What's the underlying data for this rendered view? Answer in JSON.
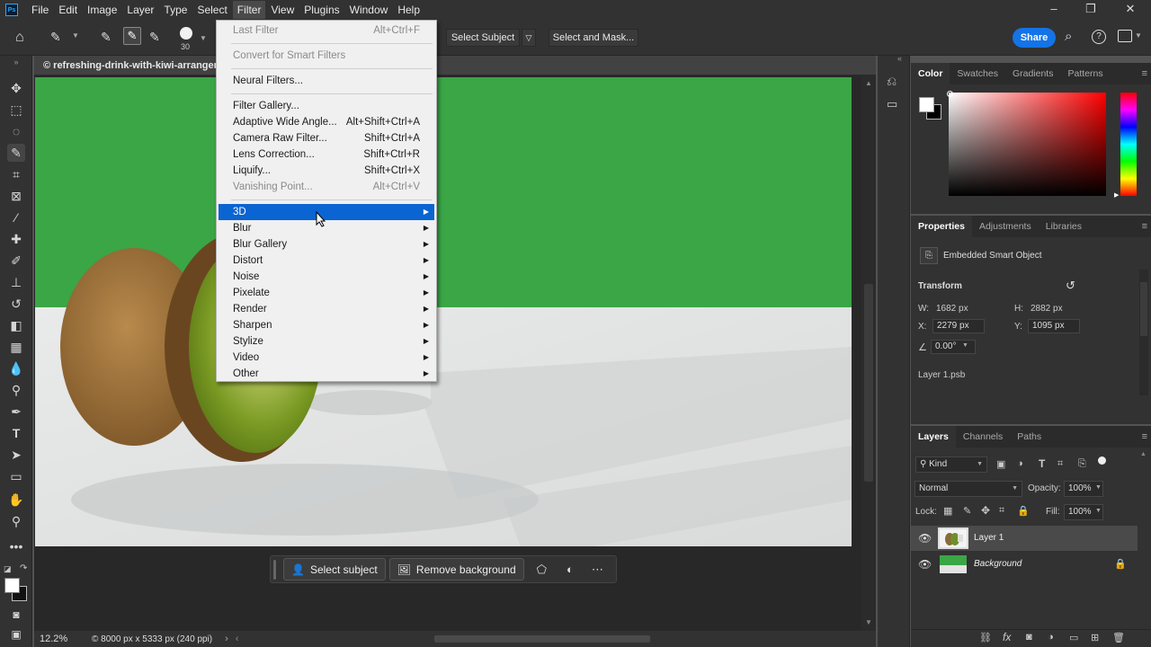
{
  "menubar": {
    "logo": "Ps",
    "items": [
      "File",
      "Edit",
      "Image",
      "Layer",
      "Type",
      "Select",
      "Filter",
      "View",
      "Plugins",
      "Window",
      "Help"
    ],
    "active": "Filter"
  },
  "options": {
    "brush_size": "30",
    "select_subject": "Select Subject",
    "select_and_mask": "Select and Mask...",
    "share": "Share"
  },
  "document": {
    "tab_title": "© refreshing-drink-with-kiwi-arrangem",
    "zoom": "12.2%",
    "doc_info": "© 8000 px x 5333 px (240 ppi)"
  },
  "filter_menu": {
    "items": [
      {
        "label": "Last Filter",
        "shortcut": "Alt+Ctrl+F",
        "disabled": true
      },
      {
        "label": "Convert for Smart Filters",
        "shortcut": "",
        "disabled": true
      },
      {
        "label": "Neural Filters...",
        "shortcut": ""
      },
      {
        "label": "Filter Gallery...",
        "shortcut": ""
      },
      {
        "label": "Adaptive Wide Angle...",
        "shortcut": "Alt+Shift+Ctrl+A"
      },
      {
        "label": "Camera Raw Filter...",
        "shortcut": "Shift+Ctrl+A"
      },
      {
        "label": "Lens Correction...",
        "shortcut": "Shift+Ctrl+R"
      },
      {
        "label": "Liquify...",
        "shortcut": "Shift+Ctrl+X"
      },
      {
        "label": "Vanishing Point...",
        "shortcut": "Alt+Ctrl+V",
        "disabled": true
      },
      {
        "label": "3D",
        "submenu": true,
        "highlighted": true
      },
      {
        "label": "Blur",
        "submenu": true
      },
      {
        "label": "Blur Gallery",
        "submenu": true
      },
      {
        "label": "Distort",
        "submenu": true
      },
      {
        "label": "Noise",
        "submenu": true
      },
      {
        "label": "Pixelate",
        "submenu": true
      },
      {
        "label": "Render",
        "submenu": true
      },
      {
        "label": "Sharpen",
        "submenu": true
      },
      {
        "label": "Stylize",
        "submenu": true
      },
      {
        "label": "Video",
        "submenu": true
      },
      {
        "label": "Other",
        "submenu": true
      }
    ]
  },
  "taskbar": {
    "select_subject": "Select subject",
    "remove_background": "Remove background"
  },
  "color_panel": {
    "tabs": [
      "Color",
      "Swatches",
      "Gradients",
      "Patterns"
    ],
    "active": "Color"
  },
  "properties_panel": {
    "tabs": [
      "Properties",
      "Adjustments",
      "Libraries"
    ],
    "active": "Properties",
    "object_type": "Embedded Smart Object",
    "transform_label": "Transform",
    "w_label": "W:",
    "w": "1682 px",
    "h_label": "H:",
    "h": "2882 px",
    "x_label": "X:",
    "x": "2279 px",
    "y_label": "Y:",
    "y": "1095 px",
    "angle": "0.00°",
    "file": "Layer 1.psb"
  },
  "layers_panel": {
    "tabs": [
      "Layers",
      "Channels",
      "Paths"
    ],
    "active": "Layers",
    "kind": "Kind",
    "blend_mode": "Normal",
    "opacity_label": "Opacity:",
    "opacity": "100%",
    "lock_label": "Lock:",
    "fill_label": "Fill:",
    "fill": "100%",
    "layers": [
      {
        "name": "Layer 1",
        "selected": true
      },
      {
        "name": "Background",
        "italic": true,
        "locked": true
      }
    ]
  },
  "colors": {
    "menu_highlight": "#0a64d2",
    "share_button": "#1473e6",
    "image_green": "#3aa646"
  }
}
